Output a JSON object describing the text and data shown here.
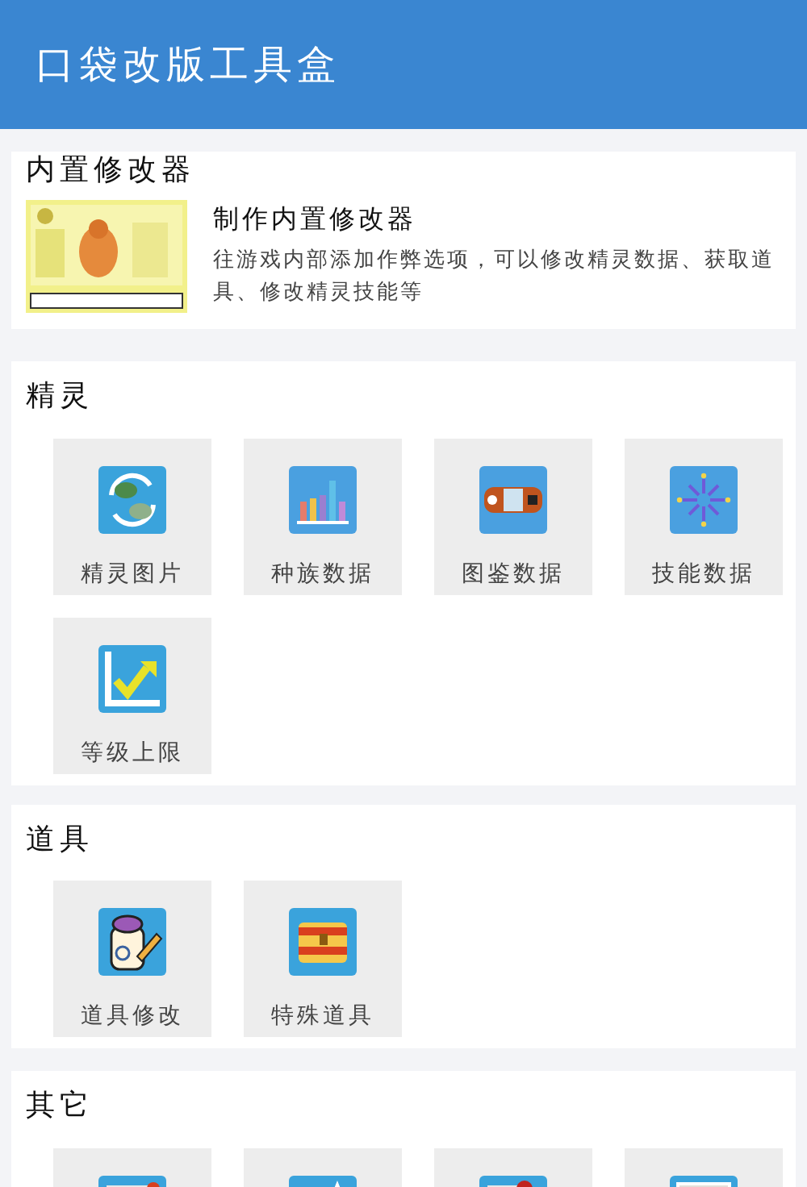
{
  "header": {
    "title": "口袋改版工具盒"
  },
  "sections": [
    {
      "title": "内置修改器",
      "kind": "feature",
      "feature": {
        "title": "制作内置修改器",
        "description": "往游戏内部添加作弊选项，可以修改精灵数据、获取道具、修改精灵技能等"
      }
    },
    {
      "title": "精灵",
      "kind": "grid",
      "items": [
        {
          "kind": "tile",
          "label": "精灵图片"
        },
        {
          "kind": "tile",
          "label": "种族数据"
        },
        {
          "kind": "tile",
          "label": "图鉴数据"
        },
        {
          "kind": "tile",
          "label": "技能数据"
        },
        {
          "kind": "tile",
          "label": "等级上限"
        }
      ]
    },
    {
      "title": "道具",
      "kind": "grid",
      "items": [
        {
          "kind": "tile",
          "label": "道具修改"
        },
        {
          "kind": "tile",
          "label": "特殊道具"
        }
      ]
    },
    {
      "title": "其它",
      "kind": "grid",
      "items": [
        {
          "kind": "cut"
        },
        {
          "kind": "cut"
        },
        {
          "kind": "cut"
        },
        {
          "kind": "cut"
        }
      ]
    }
  ]
}
